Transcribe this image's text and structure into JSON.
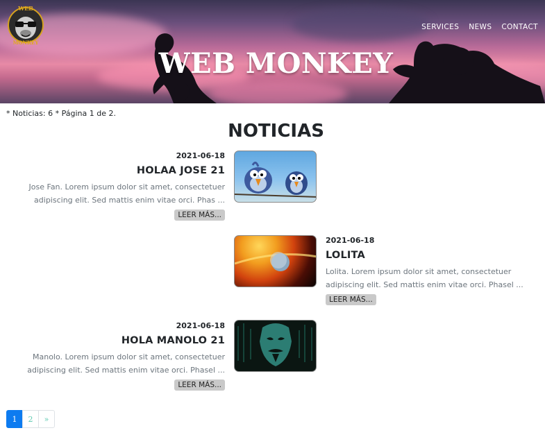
{
  "header": {
    "logo_text": "WEB MONKEY",
    "title": "WEB MONKEY",
    "nav": [
      "SERVICES",
      "NEWS",
      "CONTACT"
    ]
  },
  "summary": "* Noticias: 6 * Página 1 de 2.",
  "page_title": "NOTICIAS",
  "news": [
    {
      "date": "2021-06-18",
      "title": "HOLAA JOSE 21",
      "excerpt": "Jose Fan. Lorem ipsum dolor sit amet, consectetuer adipiscing elit. Sed mattis enim vitae orci. Phas ...",
      "button": "LEER MÁS...",
      "image": "cartoon-birds-on-wire"
    },
    {
      "date": "2021-06-18",
      "title": "LOLITA",
      "excerpt": "Lolita. Lorem ipsum dolor sit amet, consectetuer adipiscing elit. Sed mattis enim vitae orci. Phasel ...",
      "button": "LEER MÁS...",
      "image": "sun-and-planet"
    },
    {
      "date": "2021-06-18",
      "title": "HOLA MANOLO 21",
      "excerpt": "Manolo. Lorem ipsum dolor sit amet, consectetuer adipiscing elit. Sed mattis enim vitae orci. Phasel ...",
      "button": "LEER MÁS...",
      "image": "hacker-mask"
    }
  ],
  "pagination": [
    "1",
    "2",
    "»"
  ],
  "colors": {
    "pagination_active": "#0d7bf0",
    "pagination_link": "#5cc9b0",
    "button_bg": "#c9c9c9"
  }
}
